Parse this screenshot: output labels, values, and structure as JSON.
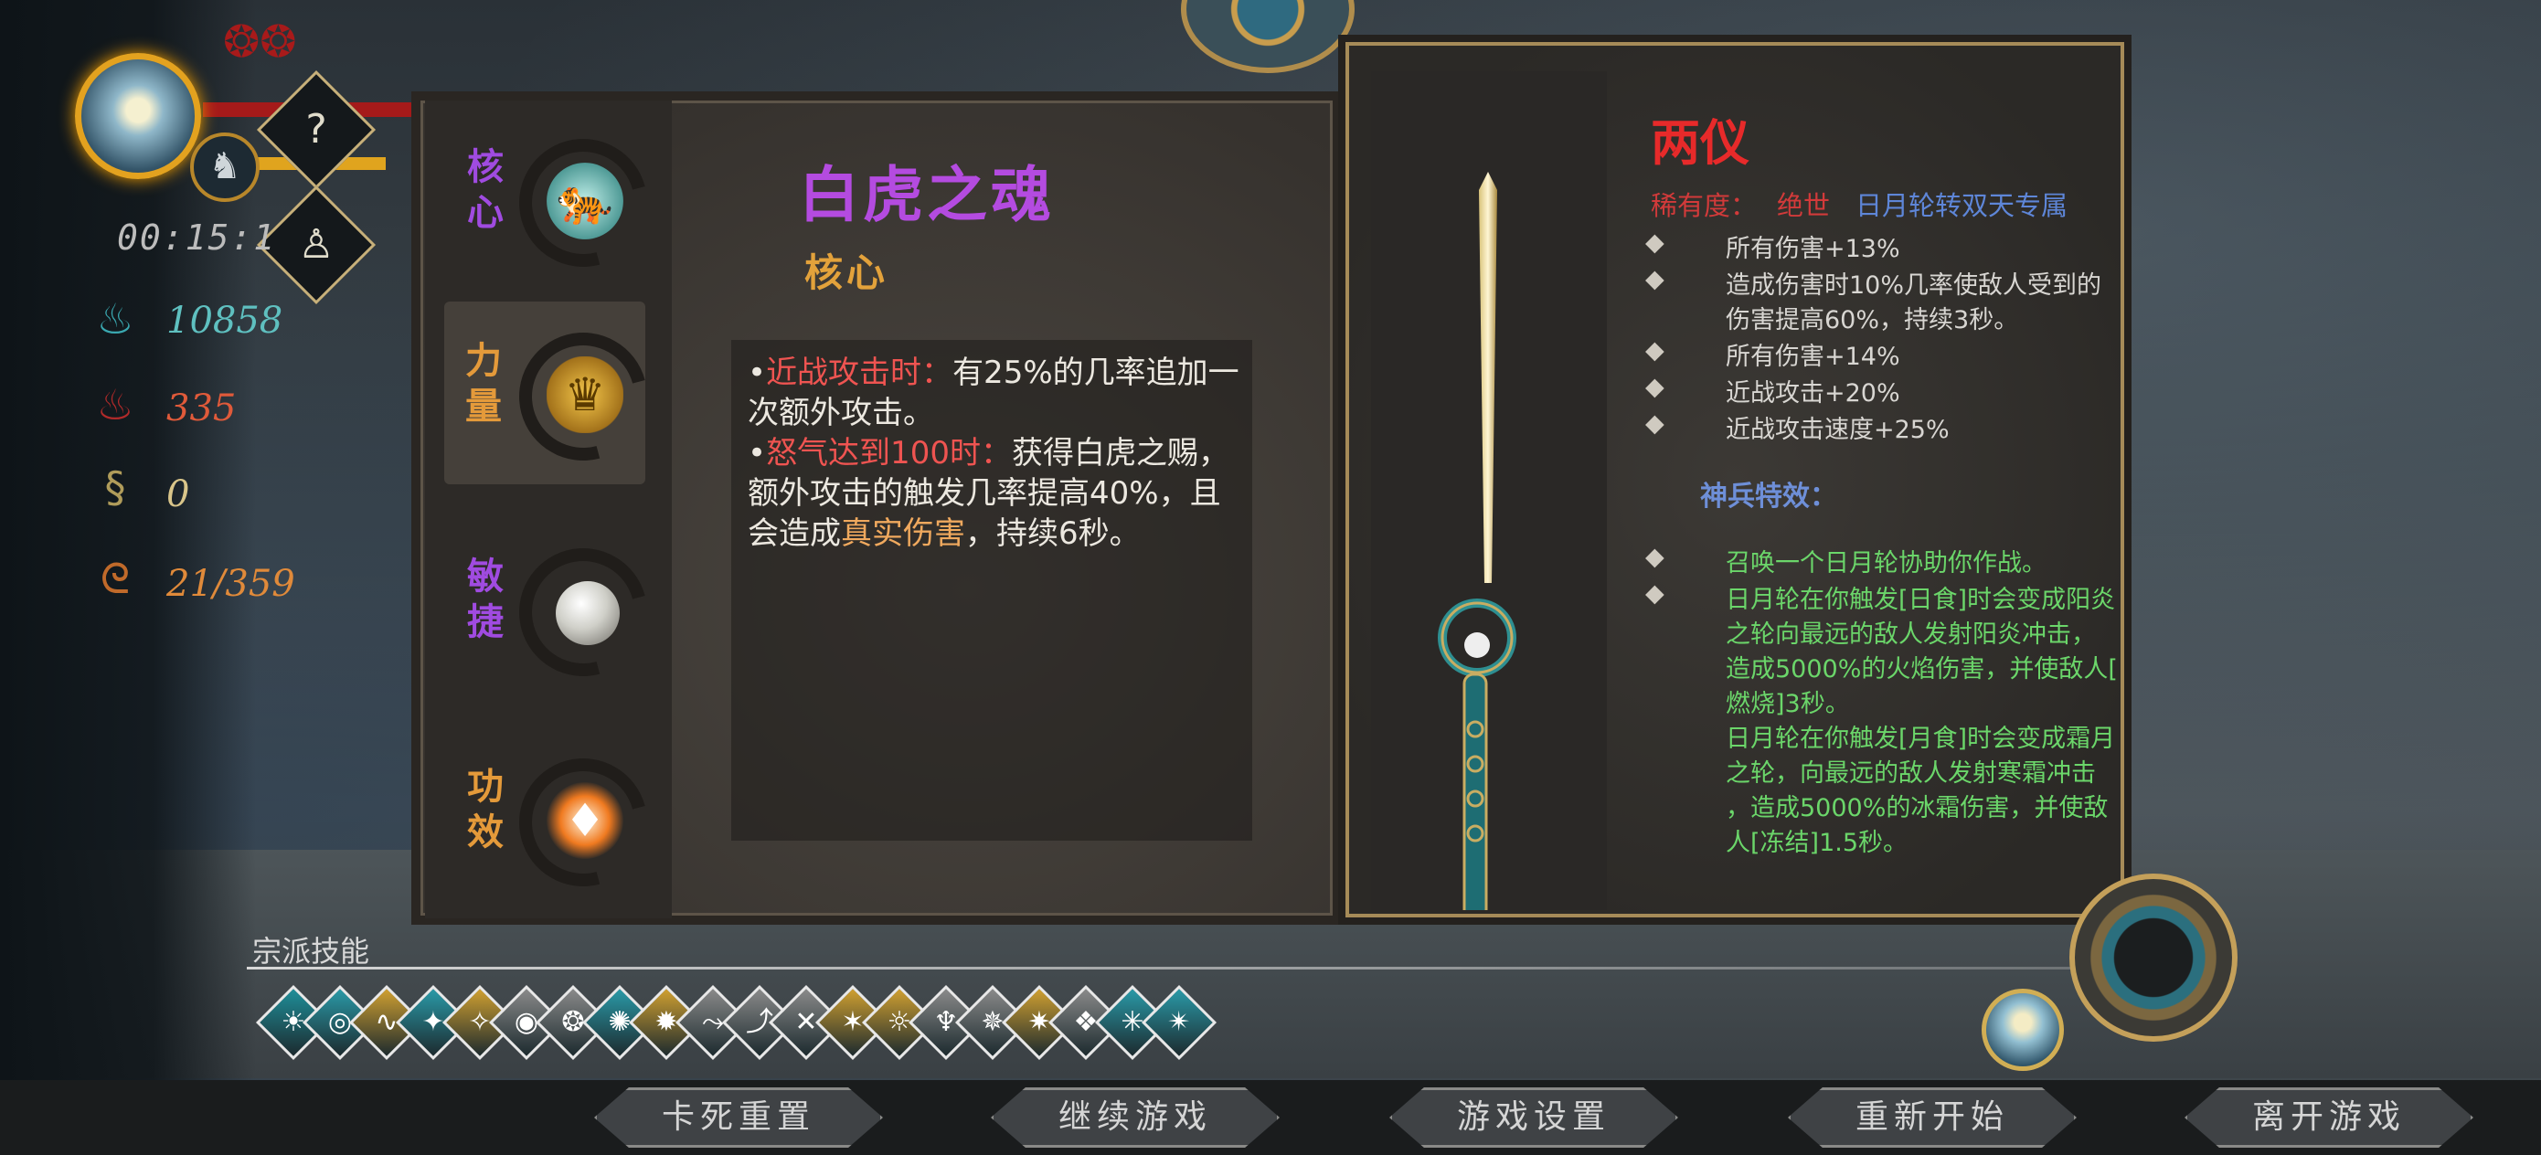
{
  "hud": {
    "timer": "00:15:1",
    "help_icon": "?",
    "stats": [
      {
        "icon": "soul-flame-icon",
        "value": "10858",
        "color": "#5fc0c0"
      },
      {
        "icon": "red-flame-icon",
        "value": "335",
        "color": "#e05a3a"
      },
      {
        "icon": "serpent-icon",
        "value": "0",
        "color": "#d9c58a"
      },
      {
        "icon": "spiral-icon",
        "value": "21/359",
        "color": "#e08a3a"
      }
    ]
  },
  "skill_panel": {
    "tabs": [
      {
        "label": "核心",
        "color": "#a04be0",
        "orb": "white-tiger-icon"
      },
      {
        "label": "力量",
        "color": "#e49a3a",
        "orb": "golden-seal-icon"
      },
      {
        "label": "敏捷",
        "color": "#a04be0",
        "orb": "pearl-icon"
      },
      {
        "label": "功效",
        "color": "#e49a3a",
        "orb": "flame-crystal-icon"
      }
    ],
    "title": "白虎之魂",
    "subtitle": "核心",
    "desc": {
      "b1_label": "近战攻击时：",
      "b1_text": "有25%的几率追加一次额外攻击。",
      "b2_label": "怒气达到100时：",
      "b2_text_a": "获得白虎之赐，额外攻击的触发几率提高40%，且会造成",
      "b2_highlight": "真实伤害",
      "b2_text_b": "，持续6秒。"
    }
  },
  "weapon_panel": {
    "name": "两仪",
    "rarity_label": "稀有度：",
    "rarity_value": "绝世",
    "exclusive": "日月轮转双天专属",
    "attributes": [
      "所有伤害+13%",
      "造成伤害时10%几率使敌人受到的",
      "伤害提高60%，持续3秒。",
      "所有伤害+14%",
      "近战攻击+20%",
      "近战攻击速度+25%"
    ],
    "special_header": "神兵特效：",
    "special_lines": [
      "召唤一个日月轮协助你作战。",
      "日月轮在你触发[日食]时会变成阳炎",
      "之轮向最远的敌人发射阳炎冲击，",
      "造成5000%的火焰伤害，并使敌人[",
      "燃烧]3秒。",
      "日月轮在你触发[月食]时会变成霜月",
      "之轮，向最远的敌人发射寒霜冲击",
      "，造成5000%的冰霜伤害，并使敌",
      "人[冻结]1.5秒。"
    ]
  },
  "clan_skills": {
    "label": "宗派技能",
    "icons": [
      "☀",
      "◎",
      "∿",
      "✦",
      "✧",
      "◉",
      "❂",
      "✺",
      "✹",
      "⤳",
      "⤴",
      "✕",
      "✶",
      "☼",
      "♆",
      "✵",
      "✷",
      "❖",
      "✳",
      "✴"
    ]
  },
  "menu": {
    "buttons": [
      "卡死重置",
      "继续游戏",
      "游戏设置",
      "重新开始",
      "离开游戏"
    ]
  }
}
